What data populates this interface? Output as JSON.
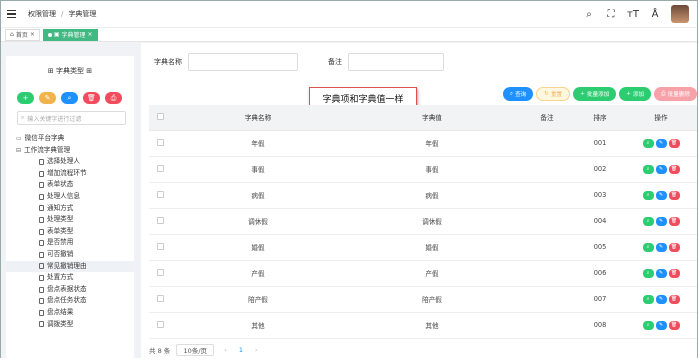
{
  "breadcrumb": {
    "root": "权限管理",
    "sep": "/",
    "current": "字典管理"
  },
  "tabs": [
    {
      "label": "首页"
    },
    {
      "label": "字典管理"
    }
  ],
  "left": {
    "title": "字典类型",
    "buttons": [
      {
        "sym": "+",
        "color": "#2ecc71"
      },
      {
        "sym": "✎",
        "color": "#f1b44c"
      },
      {
        "sym": "⌕",
        "color": "#1e90ff"
      },
      {
        "sym": "🗑",
        "color": "#f14b5c"
      },
      {
        "sym": "⎙",
        "color": "#f14b5c"
      }
    ],
    "search_placeholder": "输入关键字进行过滤",
    "tree": {
      "nodes": [
        {
          "label": "微信平台字典",
          "level": 1
        },
        {
          "label": "工作流字典管理",
          "level": 1
        },
        {
          "label": "选择处理人",
          "level": 2
        },
        {
          "label": "增加流程环节",
          "level": 2
        },
        {
          "label": "表单状态",
          "level": 2
        },
        {
          "label": "处理人信息",
          "level": 2
        },
        {
          "label": "通知方式",
          "level": 2
        },
        {
          "label": "处理类型",
          "level": 2
        },
        {
          "label": "表单类型",
          "level": 2
        },
        {
          "label": "是否禁用",
          "level": 2
        },
        {
          "label": "可否撤销",
          "level": 2
        },
        {
          "label": "常见撤销理由",
          "level": 2,
          "selected": true
        },
        {
          "label": "处置方式",
          "level": 2
        },
        {
          "label": "盘点表据状态",
          "level": 2
        },
        {
          "label": "盘点任务状态",
          "level": 2
        },
        {
          "label": "盘点结果",
          "level": 2
        },
        {
          "label": "调拨类型",
          "level": 2
        }
      ]
    }
  },
  "filter": {
    "name_label": "字典名称",
    "remark_label": "备注"
  },
  "callout": "字典项和字典值一样",
  "actions": [
    {
      "label": "查询",
      "icon": "⌕",
      "bg": "#1e90ff",
      "fg": "#fff"
    },
    {
      "label": "重置",
      "icon": "↻",
      "bg": "#fff8e1",
      "fg": "#f1b44c"
    },
    {
      "label": "批量添加",
      "icon": "+",
      "bg": "#2ecc71",
      "fg": "#fff"
    },
    {
      "label": "添加",
      "icon": "+",
      "bg": "#2ecc71",
      "fg": "#fff"
    },
    {
      "label": "批量删除",
      "icon": "⎙",
      "bg": "#f7a1a8",
      "fg": "#fff"
    }
  ],
  "table": {
    "headers": [
      "字典名称",
      "字典值",
      "备注",
      "排序",
      "操作"
    ],
    "rows": [
      [
        "年假",
        "年假",
        "",
        "001"
      ],
      [
        "事假",
        "事假",
        "",
        "002"
      ],
      [
        "病假",
        "病假",
        "",
        "003"
      ],
      [
        "调休假",
        "调休假",
        "",
        "004"
      ],
      [
        "婚假",
        "婚假",
        "",
        "005"
      ],
      [
        "产假",
        "产假",
        "",
        "006"
      ],
      [
        "陪产假",
        "陪产假",
        "",
        "007"
      ],
      [
        "其他",
        "其他",
        "",
        "008"
      ]
    ]
  },
  "pager": {
    "total": "共 8 条",
    "page_size": "10条/页",
    "prev": "‹",
    "page": "1",
    "next": "›"
  }
}
